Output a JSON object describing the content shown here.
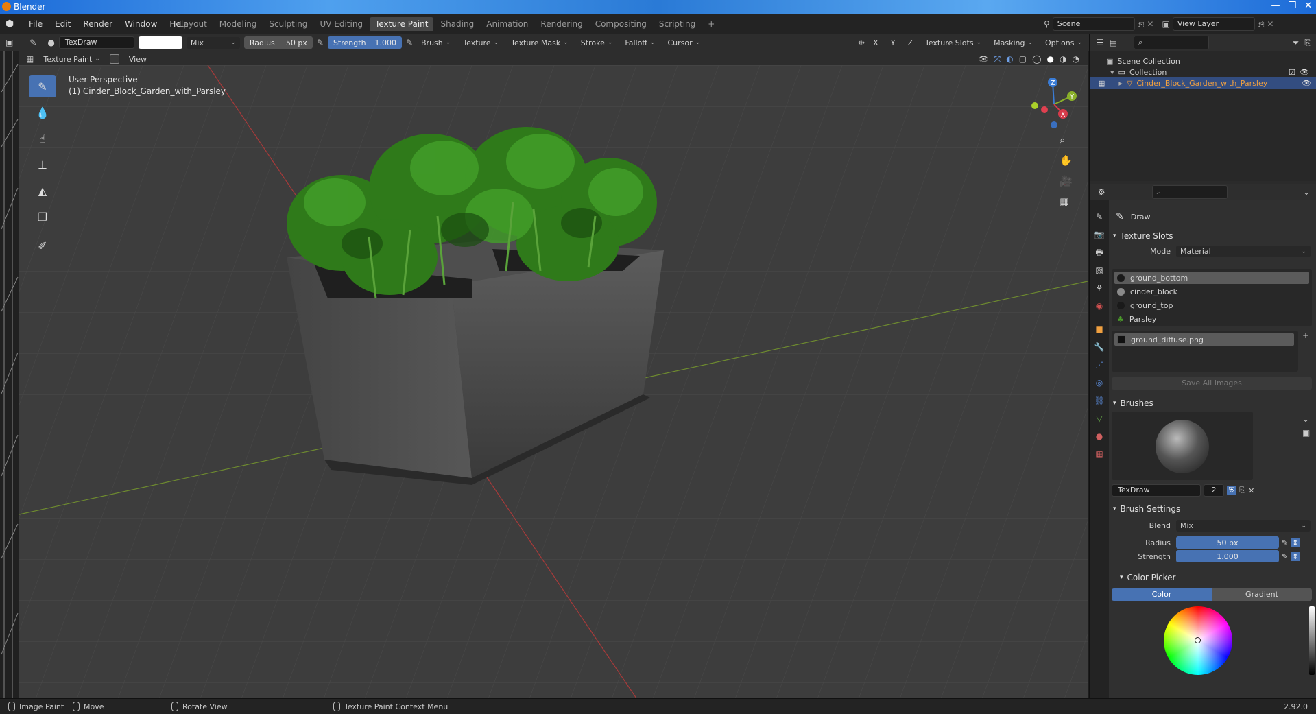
{
  "window": {
    "title": "Blender",
    "min": "—",
    "max": "❐",
    "close": "✕"
  },
  "menu": [
    "File",
    "Edit",
    "Render",
    "Window",
    "Help"
  ],
  "workspaces": [
    "Layout",
    "Modeling",
    "Sculpting",
    "UV Editing",
    "Texture Paint",
    "Shading",
    "Animation",
    "Rendering",
    "Compositing",
    "Scripting",
    "+"
  ],
  "active_workspace": "Texture Paint",
  "scene": {
    "name": "Scene",
    "view_layer": "View Layer"
  },
  "toolheader": {
    "brush_name": "TexDraw",
    "blend": "Mix",
    "radius_label": "Radius",
    "radius_value": "50 px",
    "strength_label": "Strength",
    "strength_value": "1.000",
    "menus": [
      "Brush",
      "Texture",
      "Texture Mask",
      "Stroke",
      "Falloff",
      "Cursor"
    ],
    "axes": [
      "X",
      "Y",
      "Z"
    ],
    "right_menus": [
      "Texture Slots",
      "Masking",
      "Options"
    ]
  },
  "viewheader": {
    "mode": "Texture Paint",
    "view": "View"
  },
  "viewport": {
    "line1": "User Perspective",
    "line2": "(1) Cinder_Block_Garden_with_Parsley",
    "gizmo": {
      "z": "Z",
      "y": "Y",
      "x": "X"
    }
  },
  "outliner": {
    "scene_collection": "Scene Collection",
    "collection": "Collection",
    "object": "Cinder_Block_Garden_with_Parsley"
  },
  "properties": {
    "tool_name": "Draw",
    "texture_slots": {
      "title": "Texture Slots",
      "mode_label": "Mode",
      "mode_value": "Material",
      "materials": [
        "ground_bottom",
        "cinder_block",
        "ground_top",
        "Parsley"
      ],
      "image": "ground_diffuse.png",
      "save_all": "Save All Images"
    },
    "brushes": {
      "title": "Brushes",
      "name": "TexDraw",
      "users": "2"
    },
    "brush_settings": {
      "title": "Brush Settings",
      "blend_label": "Blend",
      "blend_value": "Mix",
      "radius_label": "Radius",
      "radius_value": "50 px",
      "strength_label": "Strength",
      "strength_value": "1.000"
    },
    "color_picker": {
      "title": "Color Picker",
      "tab_color": "Color",
      "tab_gradient": "Gradient"
    }
  },
  "statusbar": {
    "image_paint": "Image Paint",
    "move": "Move",
    "rotate": "Rotate View",
    "context": "Texture Paint Context Menu",
    "version": "2.92.0"
  },
  "colors": {
    "accent": "#4772b3",
    "selected_object": "#f0a040",
    "bg": "#3d3d3d"
  }
}
